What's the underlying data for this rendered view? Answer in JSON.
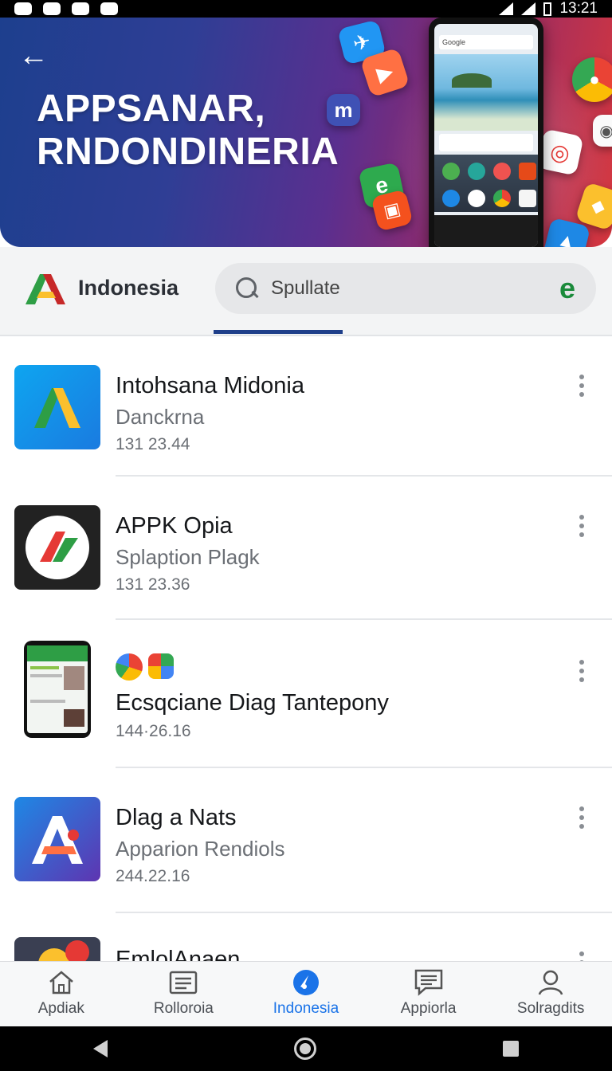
{
  "status_bar": {
    "time": "13:21"
  },
  "hero": {
    "back_glyph": "←",
    "title_line1": "APPSANAR,",
    "title_line2": "RNDONDINERIA",
    "phone_search_text": "Google"
  },
  "filter": {
    "country_label": "Indonesia",
    "search_value": "Spullate"
  },
  "apps": [
    {
      "name": "Intohsana Midonia",
      "subtitle": "Danckrna",
      "meta": "131 23.44",
      "icon": "maps-a-icon"
    },
    {
      "name": "APPK Opia",
      "subtitle": "Splaption Plagk",
      "meta": "131 23.36",
      "icon": "red-green-check-icon"
    },
    {
      "name": "Ecsqciane Diag Tantepony",
      "subtitle": "",
      "meta": "144·26.16",
      "icon": "phone-screenshot-icon"
    },
    {
      "name": "Dlag a Nats",
      "subtitle": "Apparion Rendiols",
      "meta": "244.22.16",
      "icon": "letter-a-icon"
    },
    {
      "name": "EmlolAnaen",
      "subtitle": "",
      "meta": "",
      "icon": "colorful-blob-icon"
    }
  ],
  "bottom_nav": [
    {
      "label": "Apdiak",
      "icon": "home-icon"
    },
    {
      "label": "Rolloroia",
      "icon": "list-card-icon"
    },
    {
      "label": "Indonesia",
      "icon": "compass-icon",
      "active": true
    },
    {
      "label": "Appiorla",
      "icon": "chat-list-icon"
    },
    {
      "label": "Solragdits",
      "icon": "person-icon"
    }
  ],
  "colors": {
    "accent": "#1a73e8",
    "hero_start": "#1d3f8e",
    "hero_end": "#d6363d",
    "tab_indicator": "#1f3f8a"
  }
}
